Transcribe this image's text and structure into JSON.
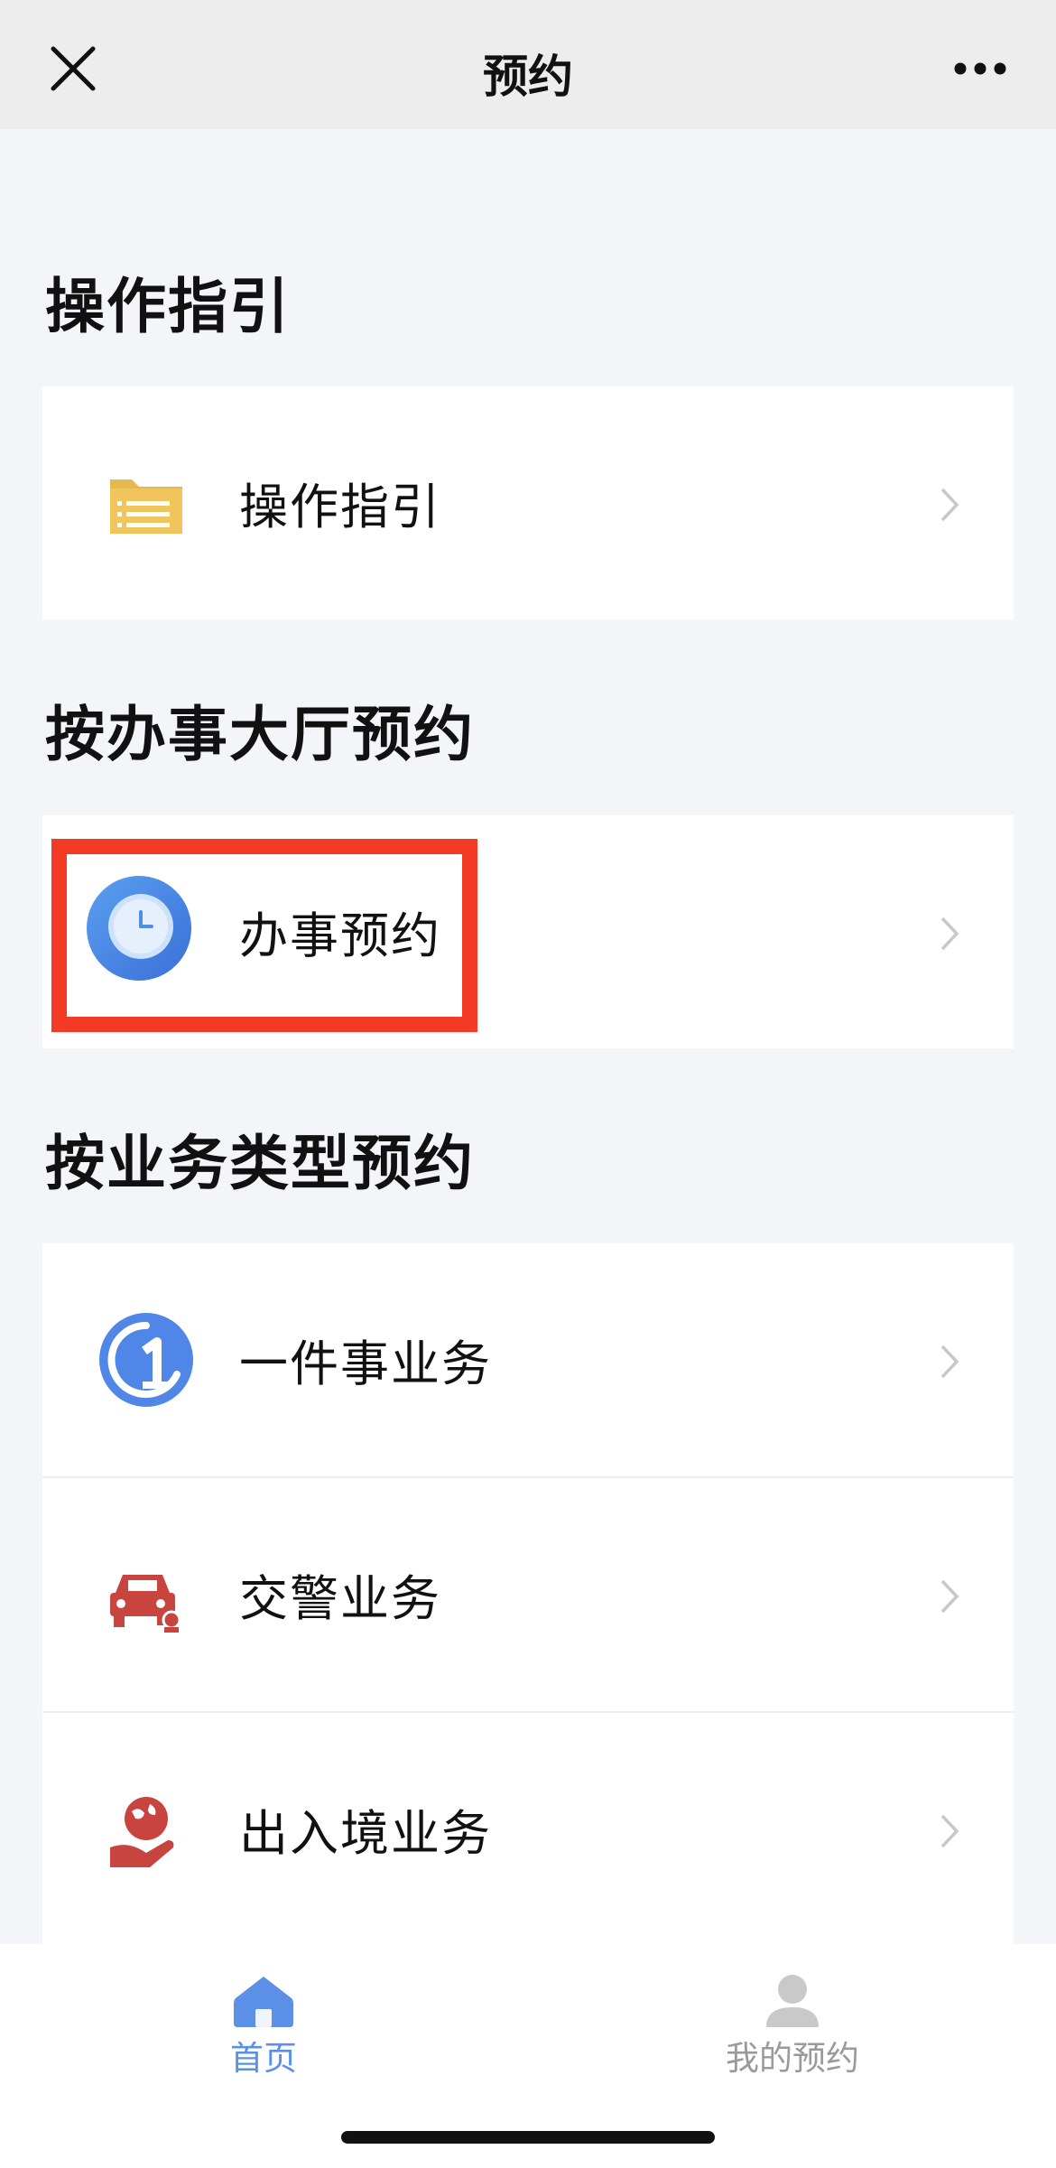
{
  "header": {
    "title": "预约",
    "close_icon": "close-icon",
    "more_icon": "more-icon"
  },
  "sections": [
    {
      "title": "操作指引",
      "items": [
        {
          "label": "操作指引",
          "icon": "folder-icon",
          "color": "#e6b94e"
        }
      ]
    },
    {
      "title": "按办事大厅预约",
      "items": [
        {
          "label": "办事预约",
          "icon": "clock-icon",
          "color": "#4f8de8"
        }
      ]
    },
    {
      "title": "按业务类型预约",
      "items": [
        {
          "label": "一件事业务",
          "icon": "number-one-icon",
          "color": "#4f86e8"
        },
        {
          "label": "交警业务",
          "icon": "car-icon",
          "color": "#c8453f"
        },
        {
          "label": "出入境业务",
          "icon": "globe-hand-icon",
          "color": "#c8453f"
        }
      ]
    }
  ],
  "tabbar": {
    "tabs": [
      {
        "label": "首页",
        "icon": "home-icon",
        "active": true,
        "color": "#5c8fe6"
      },
      {
        "label": "我的预约",
        "icon": "user-icon",
        "active": false,
        "color": "#9a9a9a"
      }
    ]
  },
  "highlight_color": "#f33a24"
}
